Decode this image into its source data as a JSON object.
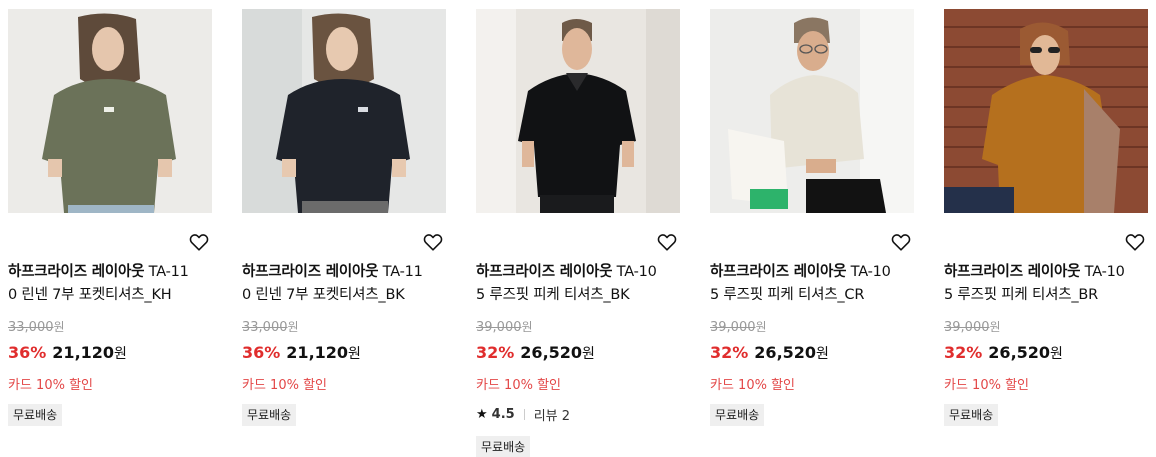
{
  "colors": {
    "discount": "#e02d2d",
    "card_discount": "#e34848",
    "badge_bg": "#efefef"
  },
  "products": [
    {
      "brand": "하프크라이즈 레이아웃",
      "name_line1": "TA-11",
      "name_line2": "0 린넨 7부 포켓티셔츠_KH",
      "original_price": "33,000",
      "won": "원",
      "discount": "36%",
      "sale_price": "21,120",
      "card_discount": "카드 10% 할인",
      "shipping": "무료배송",
      "wishlist_icon": "heart-outline-icon",
      "image_desc": "khaki-linen-tshirt-model"
    },
    {
      "brand": "하프크라이즈 레이아웃",
      "name_line1": "TA-11",
      "name_line2": "0 린넨 7부 포켓티셔츠_BK",
      "original_price": "33,000",
      "won": "원",
      "discount": "36%",
      "sale_price": "21,120",
      "card_discount": "카드 10% 할인",
      "shipping": "무료배송",
      "wishlist_icon": "heart-outline-icon",
      "image_desc": "black-linen-tshirt-model"
    },
    {
      "brand": "하프크라이즈 레이아웃",
      "name_line1": "TA-10",
      "name_line2": "5 루즈핏 피케 티셔츠_BK",
      "original_price": "39,000",
      "won": "원",
      "discount": "32%",
      "sale_price": "26,520",
      "card_discount": "카드 10% 할인",
      "rating": "4.5",
      "review_label": "리뷰 2",
      "shipping": "무료배송",
      "wishlist_icon": "heart-outline-icon",
      "image_desc": "black-pique-polo-model"
    },
    {
      "brand": "하프크라이즈 레이아웃",
      "name_line1": "TA-10",
      "name_line2": "5 루즈핏 피케 티셔츠_CR",
      "original_price": "39,000",
      "won": "원",
      "discount": "32%",
      "sale_price": "26,520",
      "card_discount": "카드 10% 할인",
      "shipping": "무료배송",
      "wishlist_icon": "heart-outline-icon",
      "image_desc": "cream-pique-polo-model"
    },
    {
      "brand": "하프크라이즈 레이아웃",
      "name_line1": "TA-10",
      "name_line2": "5 루즈핏 피케 티셔츠_BR",
      "original_price": "39,000",
      "won": "원",
      "discount": "32%",
      "sale_price": "26,520",
      "card_discount": "카드 10% 할인",
      "shipping": "무료배송",
      "wishlist_icon": "heart-outline-icon",
      "image_desc": "brown-pique-polo-model"
    }
  ]
}
